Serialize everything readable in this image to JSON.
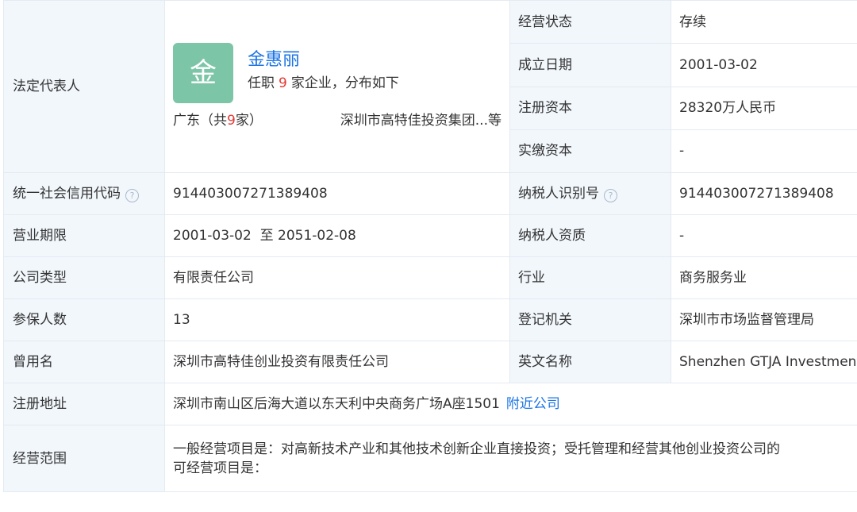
{
  "legal_rep": {
    "label": "法定代表人",
    "avatar_char": "金",
    "name": "金惠丽",
    "desc_prefix": "任职",
    "desc_count": "9",
    "desc_suffix": "家企业，分布如下",
    "province_prefix": "广东（共",
    "province_count": "9",
    "province_suffix": "家）",
    "company_summary": "深圳市高特佳投资集团...等"
  },
  "status": {
    "label": "经营状态",
    "value": "存续"
  },
  "established": {
    "label": "成立日期",
    "value": "2001-03-02"
  },
  "registered_capital": {
    "label": "注册资本",
    "value": "28320万人民币"
  },
  "paid_capital": {
    "label": "实缴资本",
    "value": "-"
  },
  "credit_code": {
    "label": "统一社会信用代码",
    "value": "914403007271389408"
  },
  "taxpayer_id": {
    "label": "纳税人识别号",
    "value": "914403007271389408"
  },
  "business_term": {
    "label": "营业期限",
    "value": "2001-03-02  至 2051-02-08"
  },
  "taxpayer_qualification": {
    "label": "纳税人资质",
    "value": "-"
  },
  "company_type": {
    "label": "公司类型",
    "value": "有限责任公司"
  },
  "industry": {
    "label": "行业",
    "value": "商务服务业"
  },
  "insured_count": {
    "label": "参保人数",
    "value": "13"
  },
  "registration_authority": {
    "label": "登记机关",
    "value": "深圳市市场监督管理局"
  },
  "former_name": {
    "label": "曾用名",
    "value": "深圳市高特佳创业投资有限责任公司"
  },
  "english_name": {
    "label": "英文名称",
    "value": "Shenzhen GTJA Investment"
  },
  "registered_address": {
    "label": "注册地址",
    "value": "深圳市南山区后海大道以东天利中央商务广场A座1501",
    "link": "附近公司"
  },
  "business_scope": {
    "label": "经营范围",
    "line1": "一般经营项目是：对高新技术产业和其他技术创新企业直接投资；受托管理和经营其他创业投资公司的",
    "line2": "可经营项目是："
  },
  "icons": {
    "help": "help-circle-icon"
  },
  "colors": {
    "label_bg": "#f2f7fc",
    "link": "#1b74e4",
    "avatar": "#7cc5a7",
    "count": "#e53935"
  }
}
